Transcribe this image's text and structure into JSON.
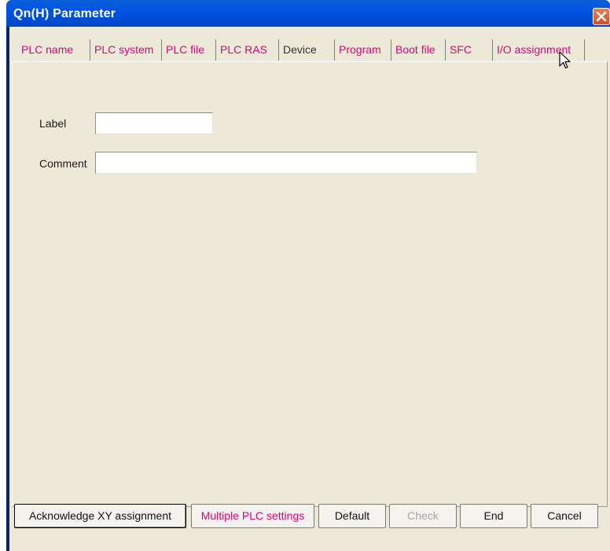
{
  "window": {
    "title": "Qn(H) Parameter"
  },
  "tabs": [
    "PLC name",
    "PLC system",
    "PLC file",
    "PLC RAS",
    "Device",
    "Program",
    "Boot file",
    "SFC",
    "I/O assignment"
  ],
  "form": {
    "label_caption": "Label",
    "label_value": "",
    "comment_caption": "Comment",
    "comment_value": ""
  },
  "buttons": {
    "acknowledge": "Acknowledge XY assignment",
    "multiple_plc": "Multiple PLC settings",
    "default": "Default",
    "check": "Check",
    "end": "End",
    "cancel": "Cancel"
  },
  "colors": {
    "title_bar": "#0054e3",
    "tab_text": "#e0007a",
    "face": "#ece9d8"
  },
  "icons": {
    "close": "close-icon",
    "pointer": "mouse-pointer-icon"
  }
}
